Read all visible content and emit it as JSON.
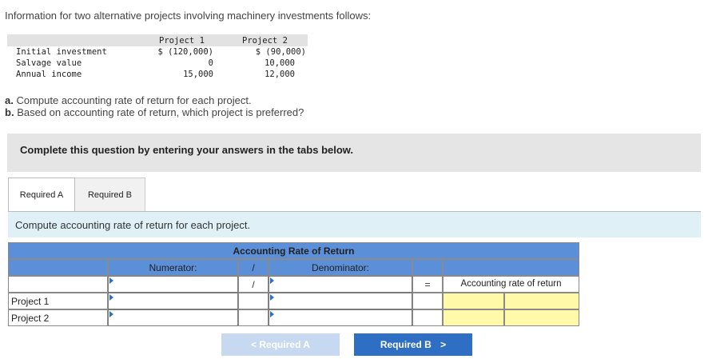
{
  "intro": "Information for two alternative projects involving machinery investments follows:",
  "table": {
    "headers": [
      "Project 1",
      "Project 2"
    ],
    "rows": [
      {
        "label": "Initial investment",
        "p1": "$ (120,000)",
        "p2": "$ (90,000)"
      },
      {
        "label": "Salvage value",
        "p1": "0",
        "p2": "10,000"
      },
      {
        "label": "Annual income",
        "p1": "15,000",
        "p2": "12,000"
      }
    ]
  },
  "questions": {
    "a_label": "a.",
    "a_text": "Compute accounting rate of return for each project.",
    "b_label": "b.",
    "b_text": "Based on accounting rate of return, which project is preferred?"
  },
  "banner": "Complete this question by entering your answers in the tabs below.",
  "tabs": [
    "Required A",
    "Required B"
  ],
  "instruction": "Compute accounting rate of return for each project.",
  "arr_table": {
    "title": "Accounting Rate of Return",
    "numerator": "Numerator:",
    "slash": "/",
    "denominator": "Denominator:",
    "equals": "=",
    "result": "Accounting rate of return",
    "rows": [
      "Project 1",
      "Project 2"
    ]
  },
  "nav": {
    "prev": "Required A",
    "next": "Required B",
    "prev_icon": "chevron-left-icon",
    "next_icon": "chevron-right-icon"
  },
  "colors": {
    "header_blue": "#5b8fd8",
    "button_blue": "#2e6fc4",
    "disabled_blue": "#c6d9f1",
    "answer_yellow": "#fff9a8"
  }
}
